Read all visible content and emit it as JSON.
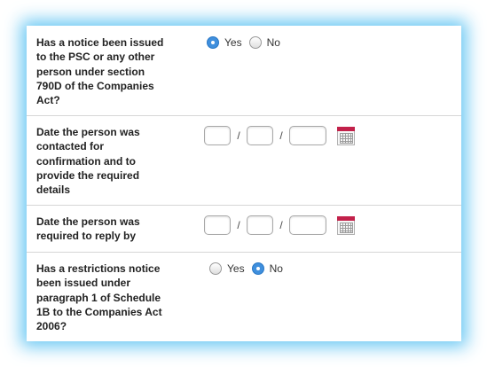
{
  "form": {
    "q1": {
      "text": "Has a notice been issued to the PSC or any other person under section 790D of the Companies Act?",
      "options": [
        {
          "label": "Yes",
          "checked": true
        },
        {
          "label": "No",
          "checked": false
        }
      ]
    },
    "q2": {
      "text": "Date the person was contacted for confirmation and to provide the required details",
      "separator": "/"
    },
    "q3": {
      "text": "Date the person was required to reply by",
      "separator": "/"
    },
    "q4": {
      "text": "Has a restrictions notice been issued under paragraph 1 of Schedule 1B to the Companies Act 2006?",
      "options": [
        {
          "label": "Yes",
          "checked": false
        },
        {
          "label": "No",
          "checked": true
        }
      ]
    }
  },
  "colors": {
    "glow": "#60c4f2",
    "radio_selected": "#3f8fdd",
    "calendar_header": "#c2214a"
  },
  "icons": {
    "calendar": "calendar-icon"
  }
}
